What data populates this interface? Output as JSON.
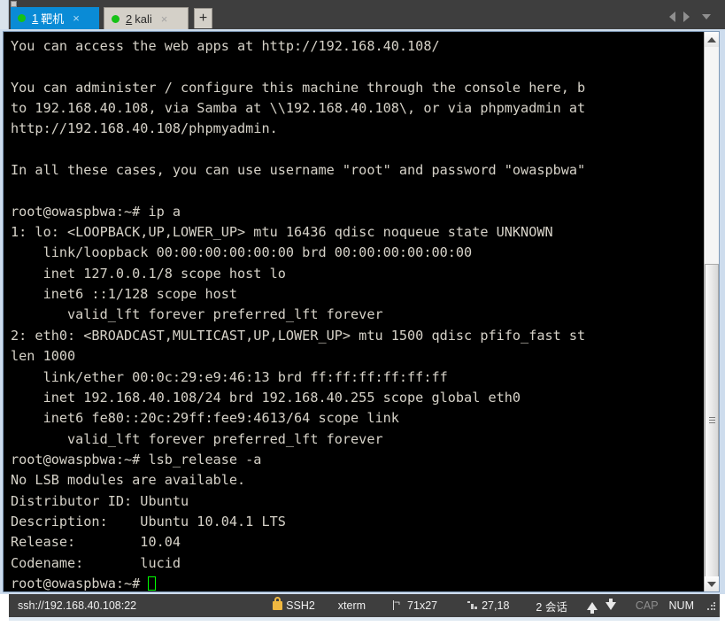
{
  "window": {
    "tabs": [
      {
        "number": "1",
        "label": "靶机",
        "active": true,
        "status_dot_color": "#16c216",
        "close_label": "×"
      },
      {
        "number": "2",
        "label": "kali",
        "active": false,
        "status_dot_color": "#16c216",
        "close_label": "×"
      }
    ],
    "new_tab_label": "+",
    "nav": {
      "prev": "◀",
      "next": "▶",
      "list": "▾"
    }
  },
  "terminal": {
    "foreground": "#d6d2c8",
    "background": "#000000",
    "cursor_color": "#00ff00",
    "lines": [
      "You can access the web apps at http://192.168.40.108/",
      "",
      "You can administer / configure this machine through the console here, b",
      "to 192.168.40.108, via Samba at \\\\192.168.40.108\\, or via phpmyadmin at",
      "http://192.168.40.108/phpmyadmin.",
      "",
      "In all these cases, you can use username \"root\" and password \"owaspbwa\"",
      "",
      "root@owaspbwa:~# ip a",
      "1: lo: <LOOPBACK,UP,LOWER_UP> mtu 16436 qdisc noqueue state UNKNOWN",
      "    link/loopback 00:00:00:00:00:00 brd 00:00:00:00:00:00",
      "    inet 127.0.0.1/8 scope host lo",
      "    inet6 ::1/128 scope host",
      "       valid_lft forever preferred_lft forever",
      "2: eth0: <BROADCAST,MULTICAST,UP,LOWER_UP> mtu 1500 qdisc pfifo_fast st",
      "len 1000",
      "    link/ether 00:0c:29:e9:46:13 brd ff:ff:ff:ff:ff:ff",
      "    inet 192.168.40.108/24 brd 192.168.40.255 scope global eth0",
      "    inet6 fe80::20c:29ff:fee9:4613/64 scope link",
      "       valid_lft forever preferred_lft forever",
      "root@owaspbwa:~# lsb_release -a",
      "No LSB modules are available.",
      "Distributor ID: Ubuntu",
      "Description:    Ubuntu 10.04.1 LTS",
      "Release:        10.04",
      "Codename:       lucid"
    ],
    "prompt": "root@owaspbwa:~# "
  },
  "scrollbar": {
    "up_label": "▲",
    "down_label": "▼"
  },
  "statusbar": {
    "url": "ssh://192.168.40.108:22",
    "protocol": "SSH2",
    "emulation": "xterm",
    "size": "71x27",
    "cursor_pos": "27,18",
    "sessions": "2 会话",
    "cap": "CAP",
    "num": "NUM"
  }
}
